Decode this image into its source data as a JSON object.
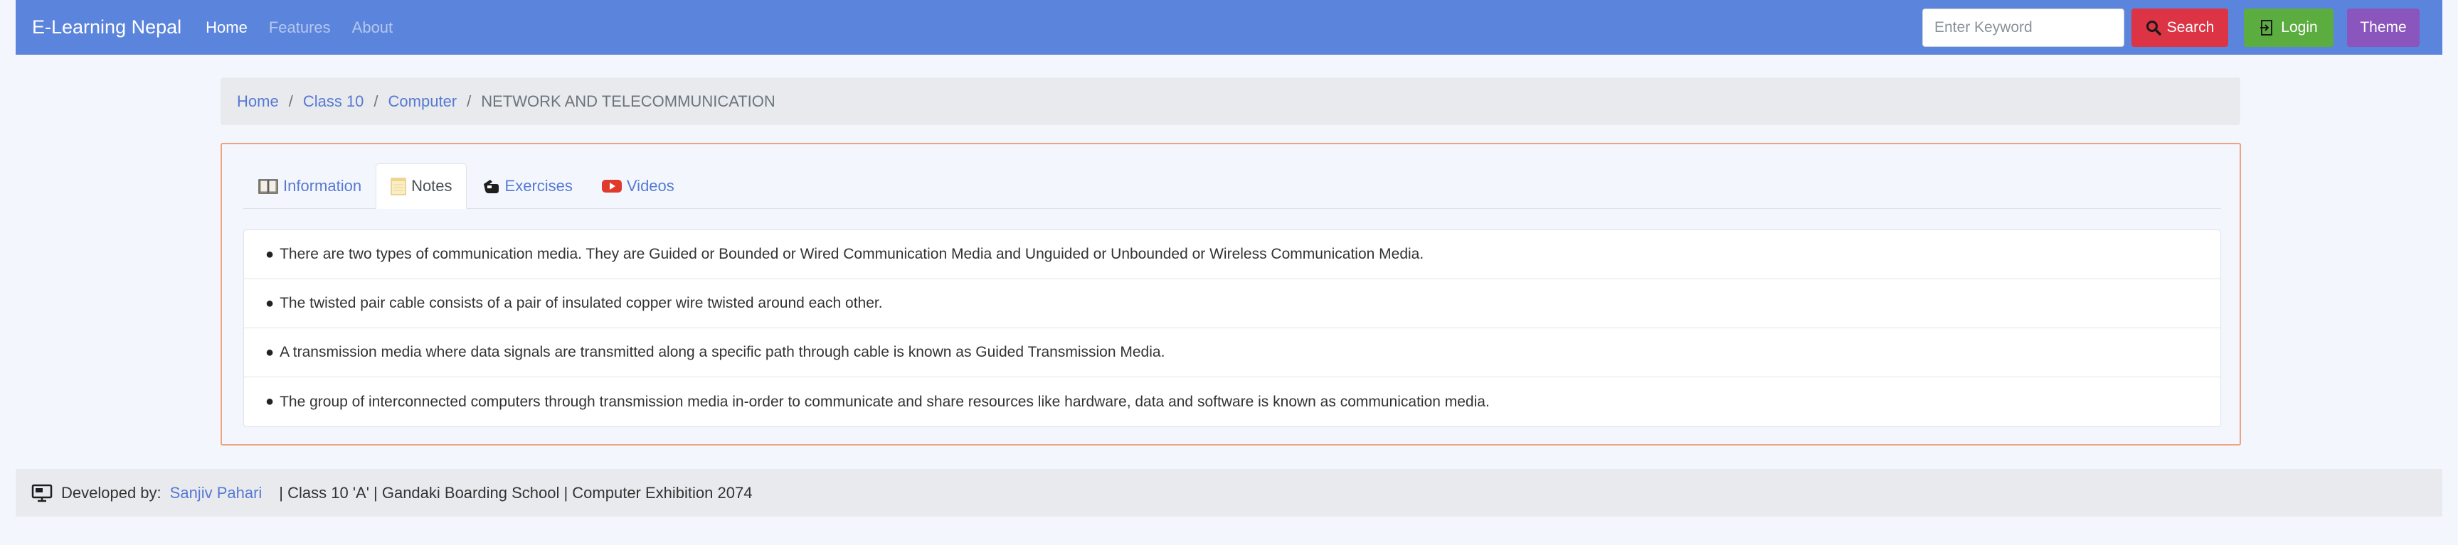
{
  "navbar": {
    "brand": "E-Learning Nepal",
    "links": [
      {
        "label": "Home",
        "active": true
      },
      {
        "label": "Features",
        "active": false
      },
      {
        "label": "About",
        "active": false
      }
    ],
    "search_placeholder": "Enter Keyword",
    "search_label": "Search",
    "login_label": "Login",
    "theme_label": "Theme"
  },
  "breadcrumb": {
    "items": [
      "Home",
      "Class 10",
      "Computer"
    ],
    "separator": "/",
    "current": "NETWORK AND TELECOMMUNICATION"
  },
  "tabs": [
    {
      "label": "Information",
      "icon": "book-icon",
      "active": false
    },
    {
      "label": "Notes",
      "icon": "notepad-icon",
      "active": true
    },
    {
      "label": "Exercises",
      "icon": "pointer-hand-icon",
      "active": false
    },
    {
      "label": "Videos",
      "icon": "youtube-icon",
      "active": false
    }
  ],
  "notes": {
    "bullet": "●",
    "items": [
      "There are two types of communication media. They are Guided or Bounded or Wired Communication Media and Unguided or Unbounded or Wireless Communication Media.",
      "The twisted pair cable consists of a pair of insulated copper wire twisted around each other.",
      "A transmission media where data signals are transmitted along a specific path through cable is known as Guided Transmission Media.",
      "The group of interconnected computers through transmission media in-order to communicate and share resources like hardware, data and software is known as communication media."
    ]
  },
  "footer": {
    "developed_by": "Developed by:",
    "developer": "Sanjiv Pahari",
    "info": "| Class 10 'A' | Gandaki Boarding School | Computer Exhibition 2074"
  },
  "colors": {
    "navbar": "#5b84dc",
    "search": "#dc3444",
    "login": "#5cad40",
    "theme": "#8a55bd",
    "link": "#5779d3",
    "card_border": "#f0a47e"
  }
}
